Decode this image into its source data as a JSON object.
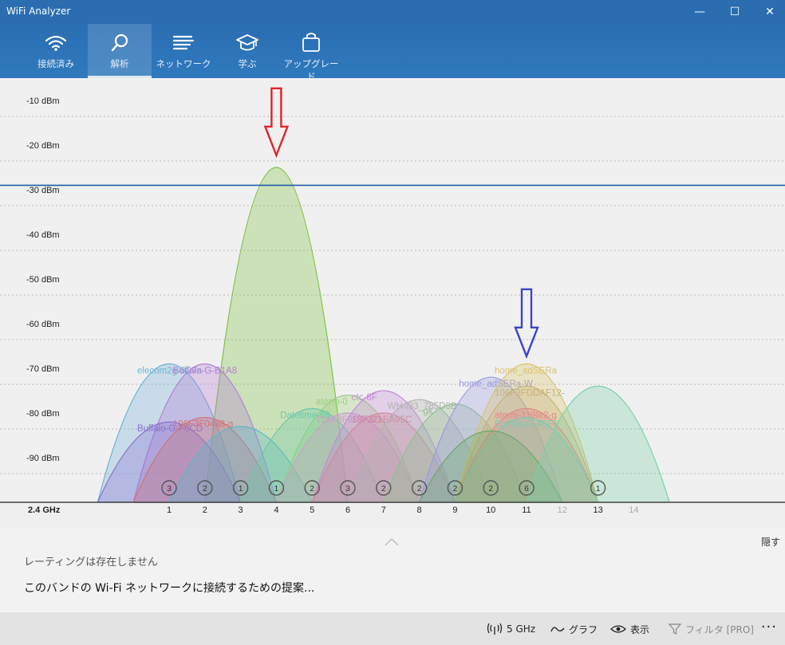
{
  "window": {
    "title": "WiFi Analyzer",
    "minimize": "—",
    "maximize": "☐",
    "close": "✕"
  },
  "nav": {
    "tabs": [
      {
        "label": "接続済み",
        "icon": "wifi-icon",
        "active": false
      },
      {
        "label": "解析",
        "icon": "magnifier-icon",
        "active": true
      },
      {
        "label": "ネットワーク",
        "icon": "list-icon",
        "active": false
      },
      {
        "label": "学ぶ",
        "icon": "graduation-cap-icon",
        "active": false
      },
      {
        "label": "アップグレード",
        "icon": "shopping-bag-icon",
        "active": false
      }
    ]
  },
  "colors": {
    "titlebar": "#2a6db1",
    "threshold_line": "#1f5fa8",
    "red_arrow": "#e0242a",
    "blue_arrow": "#3a45c8"
  },
  "chart_data": {
    "type": "area",
    "band_label": "2.4 GHz",
    "ylabels": [
      "-10 dBm",
      "-20 dBm",
      "-30 dBm",
      "-40 dBm",
      "-50 dBm",
      "-60 dBm",
      "-70 dBm",
      "-80 dBm",
      "-90 dBm"
    ],
    "ylim": [
      -100,
      -5
    ],
    "channels": [
      "1",
      "2",
      "3",
      "4",
      "5",
      "6",
      "7",
      "8",
      "9",
      "10",
      "11",
      "12",
      "13",
      "14"
    ],
    "threshold_dbm": -29,
    "grid": true,
    "networks": [
      {
        "ch": 4,
        "dbm": -25,
        "color": "#7dc142",
        "label": ""
      },
      {
        "ch": 1,
        "dbm": -69,
        "color": "#6fb1d6",
        "label": "elecom2g-6C7a"
      },
      {
        "ch": 2,
        "dbm": -69,
        "color": "#b57dd6",
        "label": "Buffalo-G-B1A8"
      },
      {
        "ch": 1,
        "dbm": -82,
        "color": "#8a6fd0",
        "label": "Buffalo-G-F6CD"
      },
      {
        "ch": 2,
        "dbm": -81,
        "color": "#d17474",
        "label": "106F3F04a8-g"
      },
      {
        "ch": 3,
        "dbm": -83,
        "color": "#58b7c8",
        "label": ""
      },
      {
        "ch": 6,
        "dbm": -76,
        "color": "#9ad07a",
        "label": "aterm-0"
      },
      {
        "ch": 5,
        "dbm": -79,
        "color": "#6ec9a8",
        "label": "Datetime-66"
      },
      {
        "ch": 6,
        "dbm": -80,
        "color": "#c9a0c9",
        "label": "106F3F989A8D"
      },
      {
        "ch": 7,
        "dbm": -75,
        "color": "#c48ad9",
        "label": "ctc-8F"
      },
      {
        "ch": 7,
        "dbm": -80,
        "color": "#d4869c",
        "label": "18F321EA95C"
      },
      {
        "ch": 8,
        "dbm": -77,
        "color": "#b2b2b2",
        "label": "WH-I33_785D8B"
      },
      {
        "ch": 9,
        "dbm": -78,
        "color": "#8fbf8f",
        "label": "gk"
      },
      {
        "ch": 10,
        "dbm": -72,
        "color": "#9a9ae0",
        "label": "home_adSERa-W"
      },
      {
        "ch": 11,
        "dbm": -69,
        "color": "#d9c36a",
        "label": "home_adSERa"
      },
      {
        "ch": 11,
        "dbm": -74,
        "color": "#c6b07a",
        "label": "106F3FDDAF12-"
      },
      {
        "ch": 11,
        "dbm": -79,
        "color": "#e08a8a",
        "label": "aterm-119fe2-g"
      },
      {
        "ch": 11,
        "dbm": -81,
        "color": "#7ec9b0",
        "label": "Buffalo-G-A5F6"
      },
      {
        "ch": 10,
        "dbm": -84,
        "color": "#6aa86a",
        "label": ""
      },
      {
        "ch": 13,
        "dbm": -74,
        "color": "#79d1a8",
        "label": ""
      }
    ],
    "channel_counts": [
      {
        "ch": 1,
        "count": "3"
      },
      {
        "ch": 2,
        "count": "2"
      },
      {
        "ch": 3,
        "count": "1"
      },
      {
        "ch": 4,
        "count": "1"
      },
      {
        "ch": 5,
        "count": "2"
      },
      {
        "ch": 6,
        "count": "3"
      },
      {
        "ch": 7,
        "count": "2"
      },
      {
        "ch": 8,
        "count": "2"
      },
      {
        "ch": 9,
        "count": "2"
      },
      {
        "ch": 10,
        "count": "2"
      },
      {
        "ch": 11,
        "count": "6"
      },
      {
        "ch": 13,
        "count": "1"
      }
    ],
    "annotations": [
      {
        "type": "arrow",
        "color": "red",
        "ch": 4,
        "dbm": -23
      },
      {
        "type": "arrow",
        "color": "blue",
        "ch": 11,
        "dbm": -68
      }
    ]
  },
  "info": {
    "hide_label": "隠す",
    "rating_text": "レーティングは存在しません",
    "suggestion_text": "このバンドの Wi-Fi ネットワークに接続するための提案..."
  },
  "bottombar": {
    "band_label": "5 GHz",
    "graph_label": "グラフ",
    "view_label": "表示",
    "filter_label": "フィルタ [PRO]",
    "more_label": "···"
  }
}
